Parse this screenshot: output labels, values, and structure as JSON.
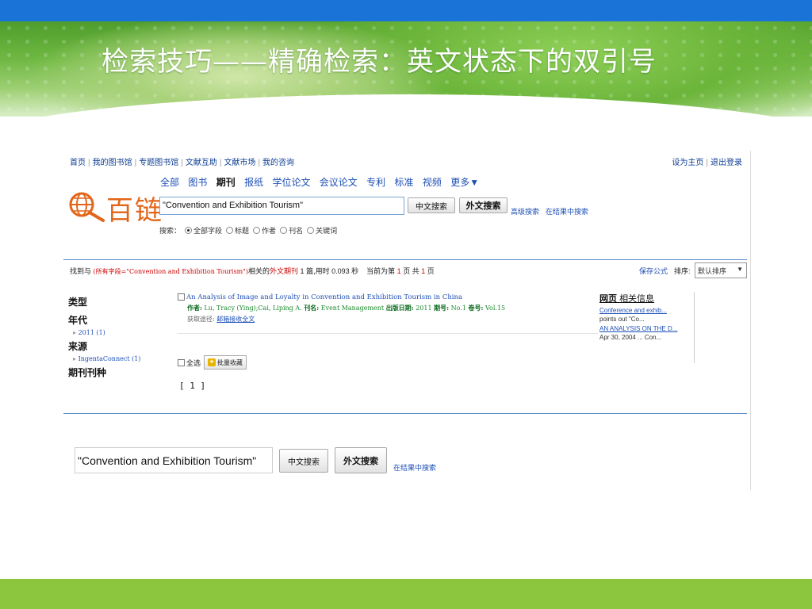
{
  "slide": {
    "title": "检索技巧——精确检索：英文状态下的双引号"
  },
  "topnav": {
    "items": [
      "首页",
      "我的图书馆",
      "专题图书馆",
      "文献互助",
      "文献市场",
      "我的咨询"
    ],
    "set_home": "设为主页",
    "logout": "退出登录"
  },
  "logo": {
    "text": "百链"
  },
  "categories": [
    "全部",
    "图书",
    "期刊",
    "报纸",
    "学位论文",
    "会议论文",
    "专利",
    "标准",
    "视频",
    "更多▼"
  ],
  "search": {
    "query": "\"Convention and Exhibition Tourism\"",
    "chinese_search": "中文搜索",
    "foreign_search": "外文搜索",
    "advanced": "高级搜索",
    "in_results": "在结果中搜索"
  },
  "scope": {
    "label": "搜索：",
    "options": [
      "全部字段",
      "标题",
      "作者",
      "刊名",
      "关键词"
    ],
    "selected": "全部字段"
  },
  "result_bar": {
    "prefix": "找到与",
    "field": "(所有字段=\"Convention and Exhibition Tourism\")",
    "related": "相关的",
    "type": "外文期刊",
    "count": "1",
    "stats": "篇,用时 0.093 秒",
    "current_prefix": "当前为第",
    "current_page": "1",
    "page_mid": "页 共",
    "total_pages": "1",
    "page_suffix": "页",
    "save_formula": "保存公式",
    "sort_label": "排序:",
    "sort_value": "默认排序"
  },
  "facets": {
    "type": "类型",
    "year": "年代",
    "year_item": "2011 (1)",
    "source": "来源",
    "source_item": "IngentaConnect (1)",
    "journal": "期刊刊种"
  },
  "result": {
    "title": "An Analysis of Image and Loyalty in Convention and Exhibition Tourism in China",
    "author_label": "作者:",
    "authors": "Lu, Tracy (Ying);Cai, Liping A.",
    "journal_label": "刊名:",
    "journal": "Event Management",
    "date_label": "出版日期:",
    "date": "2011",
    "issue_label": "期号:",
    "issue": "No.1",
    "volume_label": "卷号:",
    "volume": "Vol.15",
    "access_label": "获取途径:",
    "access_link": "邮箱接收全文"
  },
  "batch": {
    "select_all": "全选",
    "collect": "批量收藏"
  },
  "pager": "[ 1 ]",
  "related": {
    "heading_a": "网页",
    "heading_b": "相关信息",
    "link1": "Conference and exhib...",
    "text1": "points out \"Co...",
    "link2": "AN ANALYSIS ON THE D...",
    "text2": "Apr 30, 2004 ... Con..."
  },
  "bottom_search": {
    "query": "\"Convention and Exhibition Tourism\"",
    "chinese_search": "中文搜索",
    "foreign_search": "外文搜索",
    "in_results": "在结果中搜索"
  },
  "colors": {
    "top_bar": "#1a73d6",
    "bottom_bar": "#8cc63e",
    "logo": "#e2661a",
    "link": "#1d4fb5"
  }
}
